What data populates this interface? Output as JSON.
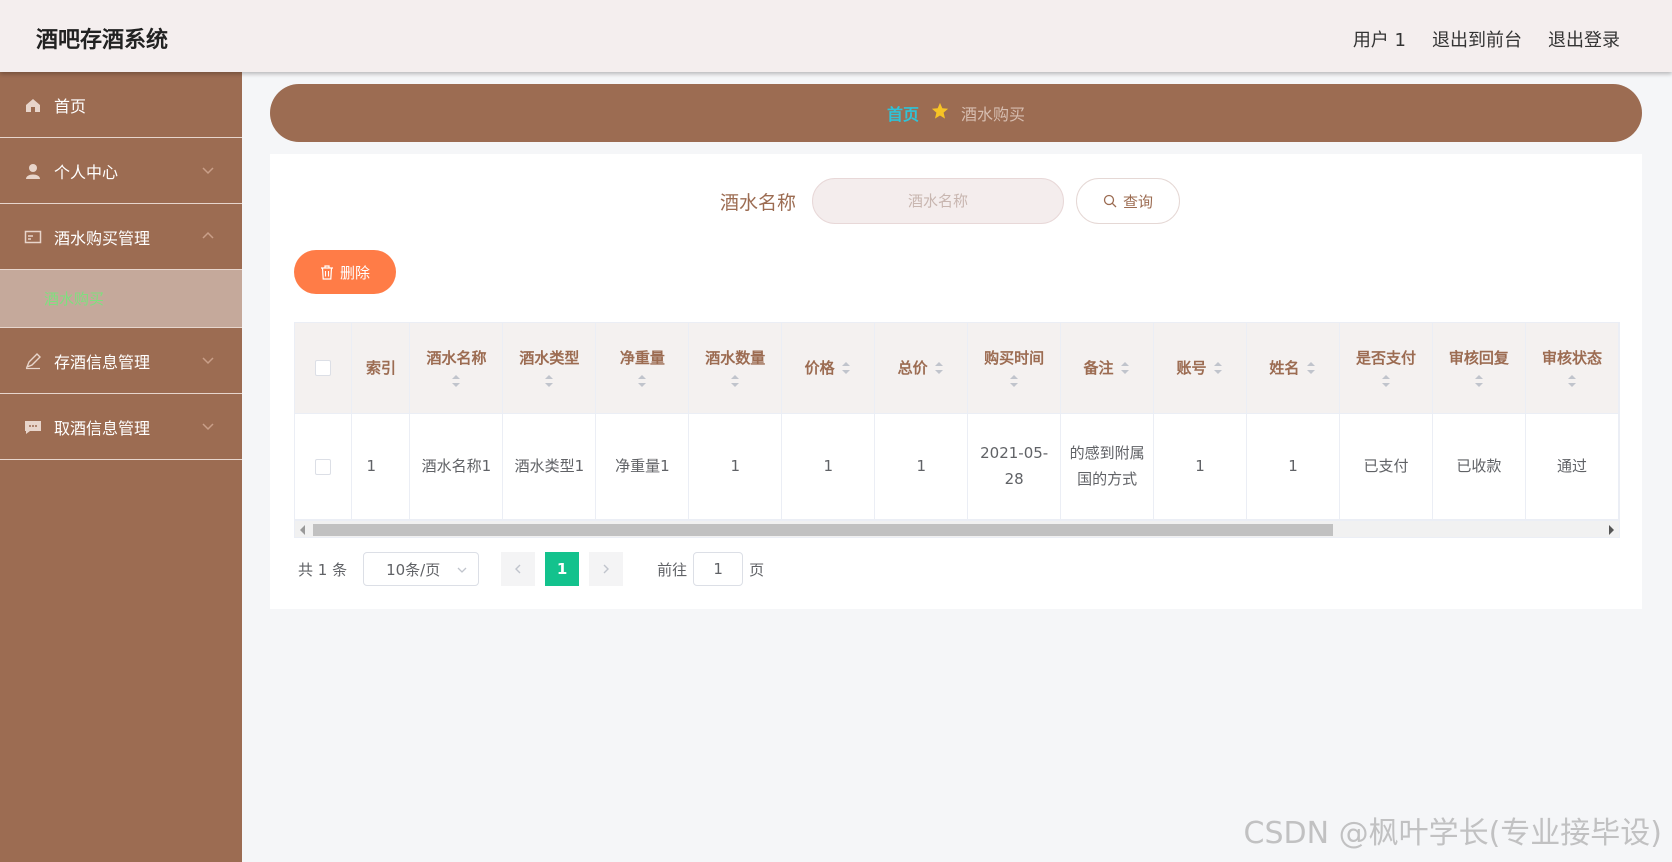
{
  "app": {
    "title": "酒吧存酒系统",
    "top_links": [
      "用户 1",
      "退出到前台",
      "退出登录"
    ]
  },
  "sidebar": {
    "items": [
      {
        "label": "首页",
        "icon": "home-icon"
      },
      {
        "label": "个人中心",
        "icon": "user-icon"
      },
      {
        "label": "酒水购买管理",
        "icon": "card-icon",
        "expanded": true
      },
      {
        "label": "存酒信息管理",
        "icon": "edit-icon"
      },
      {
        "label": "取酒信息管理",
        "icon": "chat-icon"
      }
    ],
    "active_sub": "酒水购买",
    "colors": {
      "bg": "#9c6c52",
      "sub_bg": "#c5a99b",
      "sub_text": "#7ee07e"
    }
  },
  "breadcrumb": {
    "home": "首页",
    "current": "酒水购买"
  },
  "search": {
    "label": "酒水名称",
    "placeholder": "酒水名称",
    "button": "查询"
  },
  "toolbar": {
    "delete_label": "删除"
  },
  "table": {
    "columns": [
      "索引",
      "酒水名称",
      "酒水类型",
      "净重量",
      "酒水数量",
      "价格",
      "总价",
      "购买时间",
      "备注",
      "账号",
      "姓名",
      "是否支付",
      "审核回复",
      "审核状态"
    ],
    "rows": [
      [
        "1",
        "酒水名称1",
        "酒水类型1",
        "净重量1",
        "1",
        "1",
        "1",
        "2021-05-28",
        "的感到附属国的方式",
        "1",
        "1",
        "已支付",
        "已收款",
        "通过"
      ]
    ]
  },
  "pagination": {
    "total": "共 1 条",
    "page_size": "10条/页",
    "current_page": "1",
    "goto_label": "前往",
    "goto_value": "1",
    "page_suffix": "页"
  },
  "watermark": "CSDN @枫叶学长(专业接毕设)",
  "colors": {
    "accent": "#9c6c52",
    "delete": "#ff7c47",
    "page_active": "#13c28d",
    "crumb_home": "#2fc3d8"
  }
}
